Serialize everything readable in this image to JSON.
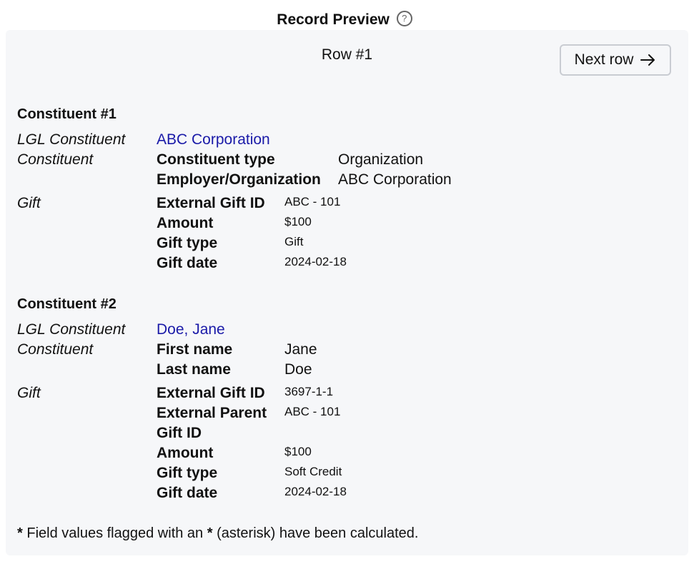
{
  "header": {
    "title": "Record Preview",
    "help_glyph": "?"
  },
  "preview": {
    "row_label": "Row #1",
    "next_label": "Next row"
  },
  "constituents": [
    {
      "heading": "Constituent #1",
      "lgl_label": "LGL Constituent",
      "lgl_value": "ABC Corporation",
      "constituent_label": "Constituent",
      "fields": [
        {
          "label": "Constituent type",
          "value": "Organization"
        },
        {
          "label": "Employer/Organization",
          "value": "ABC Corporation"
        }
      ],
      "gift_label": "Gift",
      "gift_fields": [
        {
          "label": "External Gift ID",
          "value": "ABC - 101"
        },
        {
          "label": "Amount",
          "value": "$100"
        },
        {
          "label": "Gift type",
          "value": "Gift"
        },
        {
          "label": "Gift date",
          "value": "2024-02-18"
        }
      ]
    },
    {
      "heading": "Constituent #2",
      "lgl_label": "LGL Constituent",
      "lgl_value": "Doe, Jane",
      "constituent_label": "Constituent",
      "fields": [
        {
          "label": "First name",
          "value": "Jane"
        },
        {
          "label": "Last name",
          "value": "Doe"
        }
      ],
      "gift_label": "Gift",
      "gift_fields": [
        {
          "label": "External Gift ID",
          "value": "3697-1-1"
        },
        {
          "label": "External Parent",
          "label2": "Gift ID",
          "value": "ABC - 101"
        },
        {
          "label": "Amount",
          "value": "$100"
        },
        {
          "label": "Gift type",
          "value": "Soft Credit"
        },
        {
          "label": "Gift date",
          "value": "2024-02-18"
        }
      ]
    }
  ],
  "footnote": {
    "star": "*",
    "text_a": " Field values flagged with an ",
    "star2": "*",
    "text_b": " (asterisk) have been calculated."
  },
  "icons": {
    "help": "question-circle-icon",
    "next": "arrow-right-icon"
  }
}
